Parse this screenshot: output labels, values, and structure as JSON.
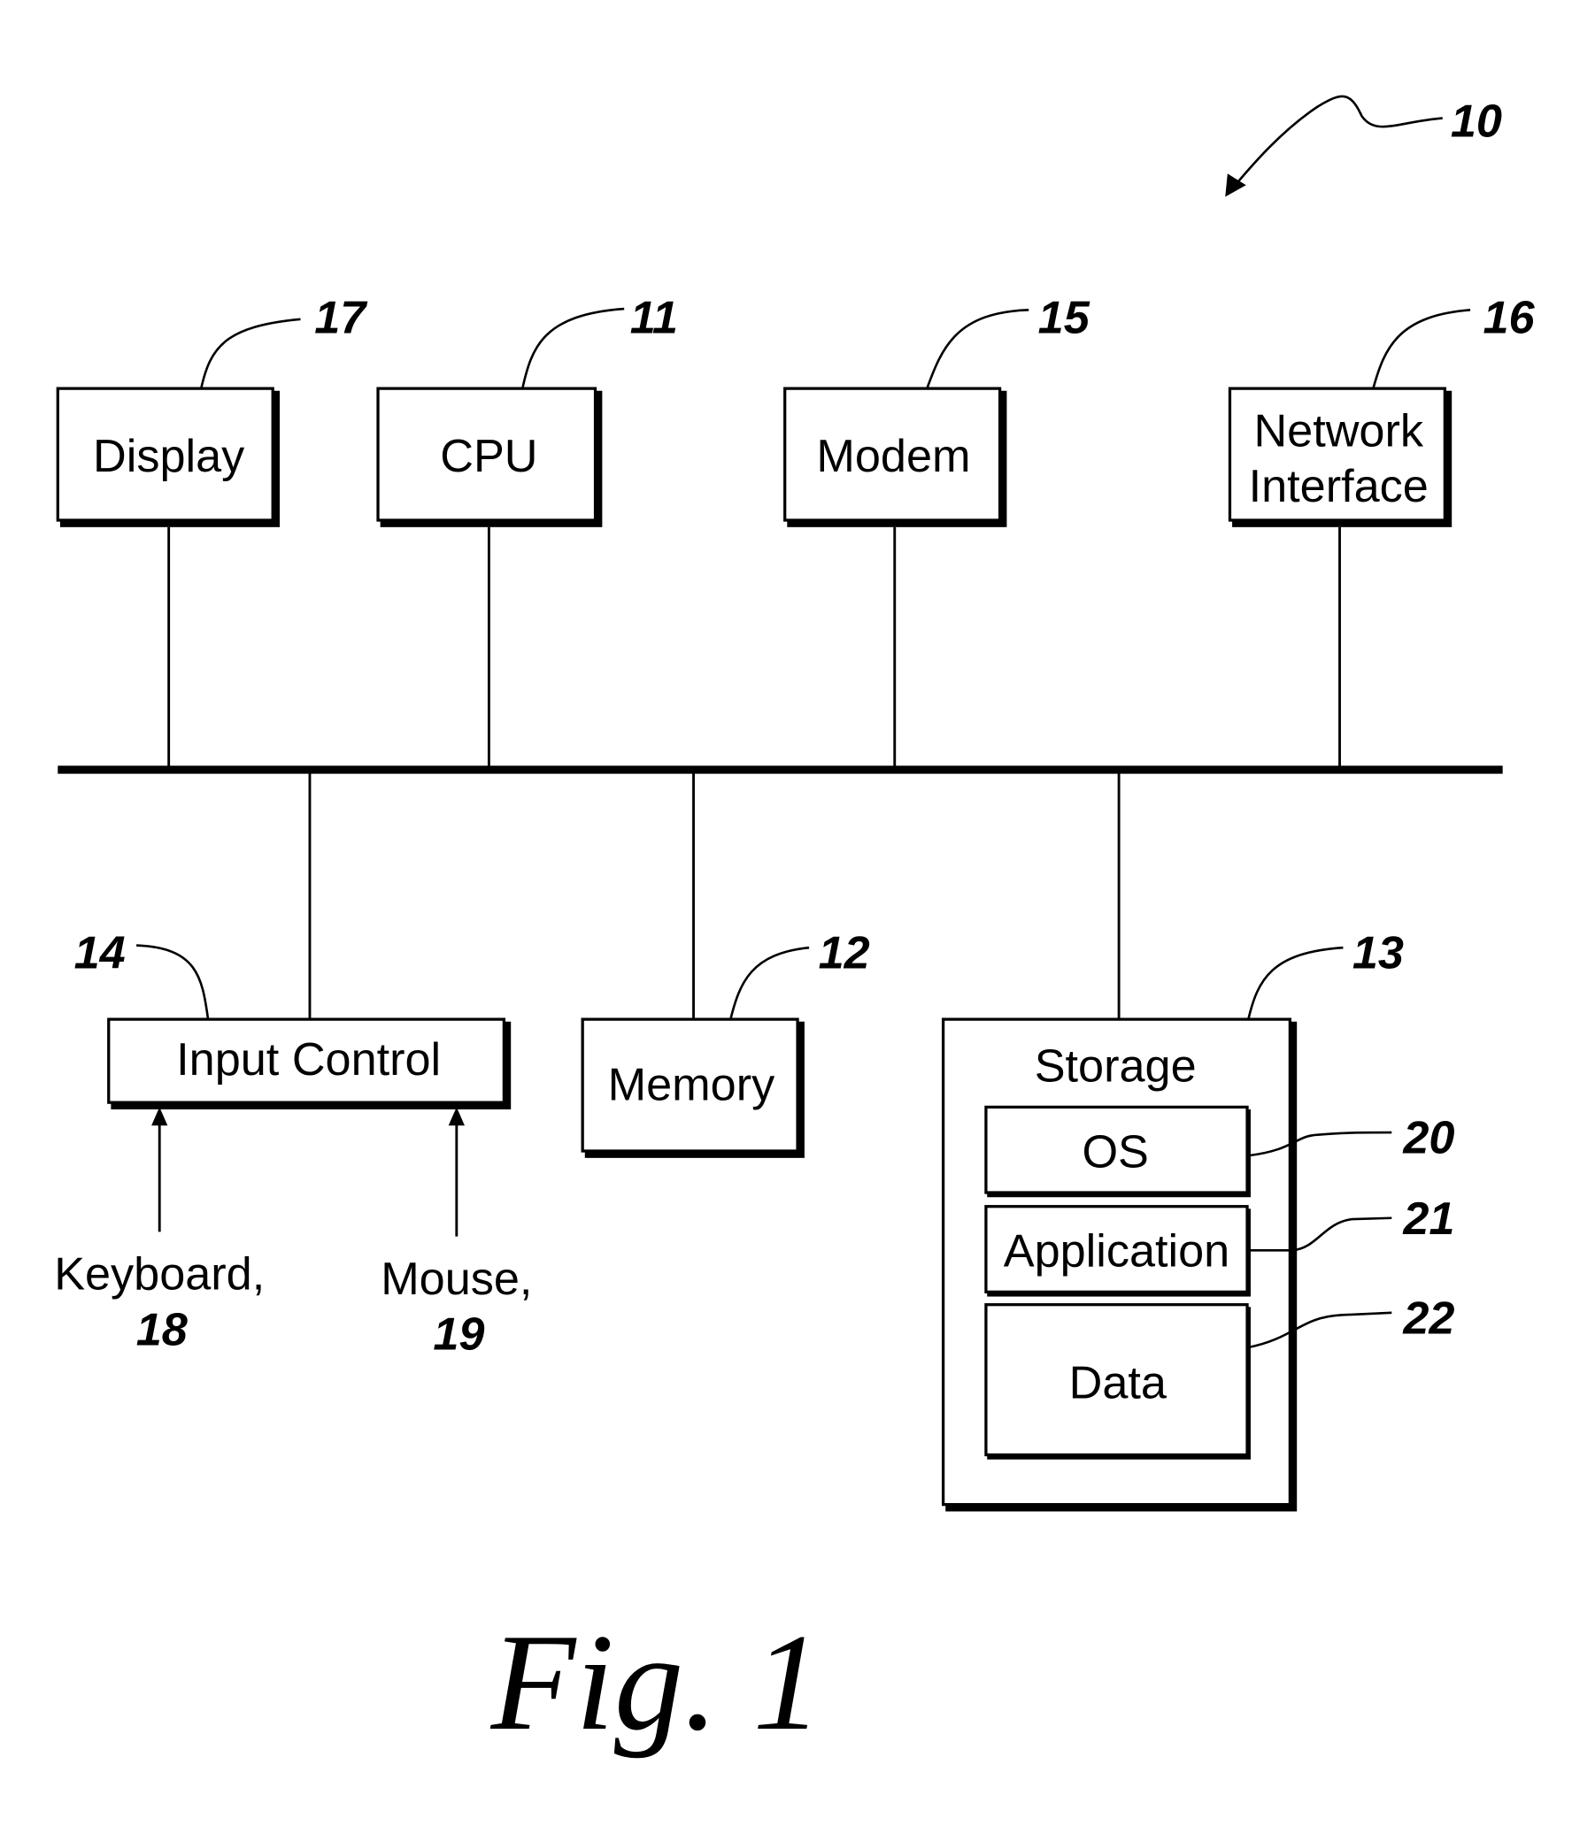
{
  "figure": {
    "caption": "Fig. 1",
    "system_ref": "10"
  },
  "components": {
    "display": {
      "label": "Display",
      "ref": "17"
    },
    "cpu": {
      "label": "CPU",
      "ref": "11"
    },
    "modem": {
      "label": "Modem",
      "ref": "15"
    },
    "network_interface": {
      "label_line1": "Network",
      "label_line2": "Interface",
      "ref": "16"
    },
    "input_control": {
      "label": "Input Control",
      "ref": "14"
    },
    "memory": {
      "label": "Memory",
      "ref": "12"
    },
    "storage": {
      "label": "Storage",
      "ref": "13"
    },
    "os": {
      "label": "OS",
      "ref": "20"
    },
    "application": {
      "label": "Application",
      "ref": "21"
    },
    "data": {
      "label": "Data",
      "ref": "22"
    }
  },
  "inputs": {
    "keyboard": {
      "label": "Keyboard,",
      "ref": "18"
    },
    "mouse": {
      "label": "Mouse,",
      "ref": "19"
    }
  }
}
